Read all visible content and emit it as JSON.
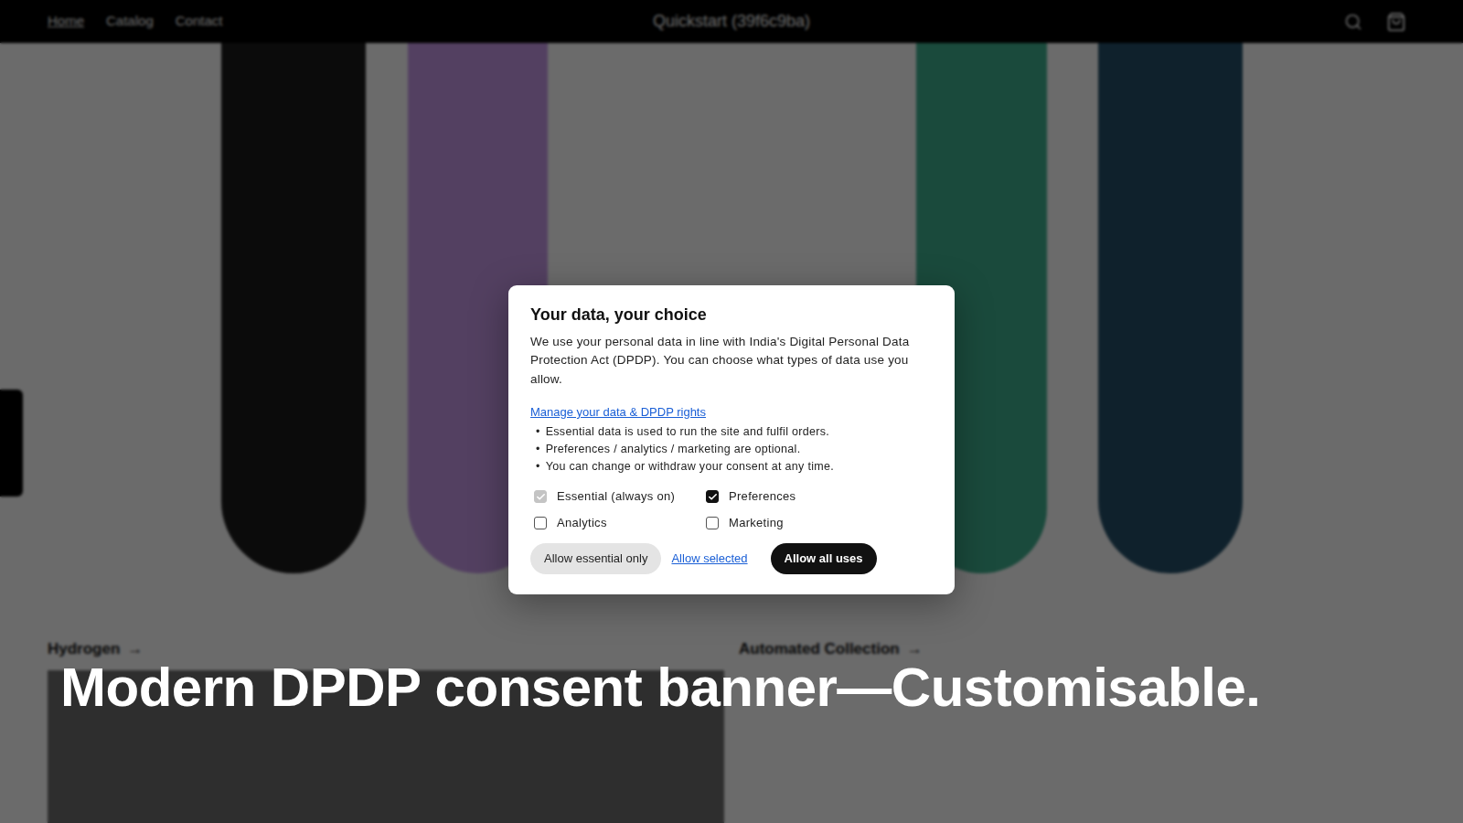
{
  "store": {
    "nav": {
      "links": [
        {
          "label": "Home",
          "selected": true
        },
        {
          "label": "Catalog",
          "selected": false
        },
        {
          "label": "Contact",
          "selected": false
        }
      ],
      "title": "Quickstart (39f6c9ba)"
    },
    "collections": [
      {
        "label": "Hydrogen",
        "arrow": "→"
      },
      {
        "label": "Automated Collection",
        "arrow": "→"
      }
    ]
  },
  "consent": {
    "title": "Your data, your choice",
    "body": "We use your personal data in line with India's Digital Personal Data Protection Act (DPDP). You can choose what types of data use you allow.",
    "link": "Manage your data & DPDP rights",
    "bullet": "•",
    "bullets": [
      "Essential data is used to run the site and fulfil orders.",
      "Preferences / analytics / marketing are optional.",
      "You can change or withdraw your consent at any time."
    ],
    "options": [
      {
        "label": "Essential (always on)",
        "checked": true,
        "disabled": true
      },
      {
        "label": "Preferences",
        "checked": true,
        "disabled": false
      },
      {
        "label": "Analytics",
        "checked": false,
        "disabled": false
      },
      {
        "label": "Marketing",
        "checked": false,
        "disabled": false
      }
    ],
    "buttons": [
      {
        "label": "Allow essential only",
        "kind": "secondary"
      },
      {
        "label": "Allow selected",
        "kind": "link"
      },
      {
        "label": "Allow all uses",
        "kind": "primary"
      }
    ]
  },
  "caption": "Modern DPDP consent banner—Customisable."
}
